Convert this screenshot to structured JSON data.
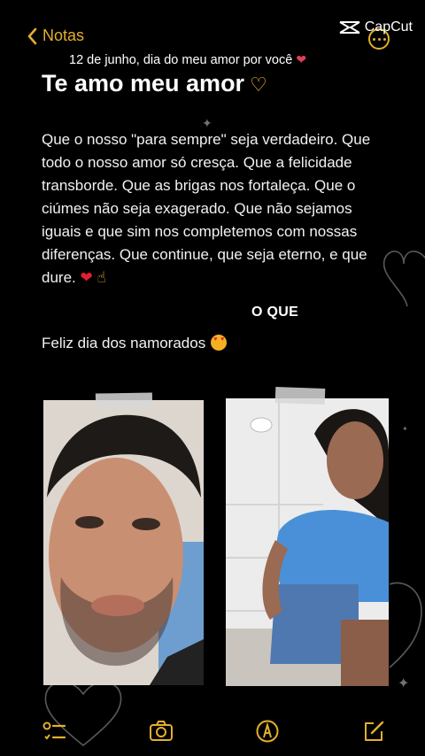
{
  "nav": {
    "back_label": "Notas"
  },
  "watermark": {
    "text": "CapCut"
  },
  "note": {
    "date_line": "12 de junho, dia do meu amor por você",
    "title": "Te amo meu amor",
    "body": "Que o nosso \"para sempre\" seja verdadeiro. Que todo o nosso amor só cresça. Que a felicidade transborde. Que as brigas nos fortaleça. Que o ciúmes não seja exagerado. Que não sejamos iguais e que sim nos completemos com nossas diferenças. Que continue, que seja eterno, e que dure.",
    "closing": "Feliz dia dos namorados"
  },
  "overlay_caption": "O QUE",
  "icons": {
    "back": "chevron-left-icon",
    "watermark": "capcut-logo-icon",
    "more": "ellipsis-circle-icon",
    "checklist": "checklist-icon",
    "camera": "camera-icon",
    "markup": "markup-pen-icon",
    "compose": "compose-icon"
  },
  "colors": {
    "accent": "#e3b02b",
    "background": "#000000",
    "text": "#ffffff"
  }
}
